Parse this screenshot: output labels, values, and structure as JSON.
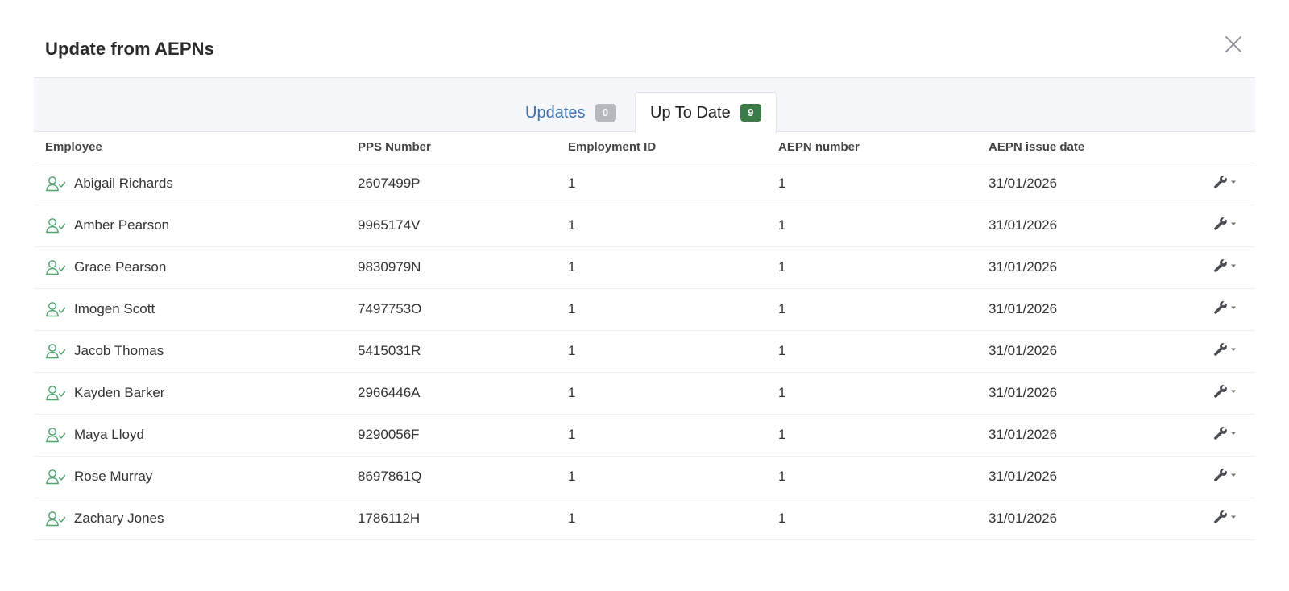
{
  "modal": {
    "title": "Update from AEPNs"
  },
  "tabs": [
    {
      "label": "Updates",
      "count": "0"
    },
    {
      "label": "Up To Date",
      "count": "9"
    }
  ],
  "table": {
    "headers": [
      "Employee",
      "PPS Number",
      "Employment ID",
      "AEPN number",
      "AEPN issue date"
    ],
    "rows": [
      {
        "name": "Abigail Richards",
        "pps": "2607499P",
        "employment_id": "1",
        "aepn_number": "1",
        "issue_date": "31/01/2026"
      },
      {
        "name": "Amber Pearson",
        "pps": "9965174V",
        "employment_id": "1",
        "aepn_number": "1",
        "issue_date": "31/01/2026"
      },
      {
        "name": "Grace Pearson",
        "pps": "9830979N",
        "employment_id": "1",
        "aepn_number": "1",
        "issue_date": "31/01/2026"
      },
      {
        "name": "Imogen Scott",
        "pps": "7497753O",
        "employment_id": "1",
        "aepn_number": "1",
        "issue_date": "31/01/2026"
      },
      {
        "name": "Jacob Thomas",
        "pps": "5415031R",
        "employment_id": "1",
        "aepn_number": "1",
        "issue_date": "31/01/2026"
      },
      {
        "name": "Kayden Barker",
        "pps": "2966446A",
        "employment_id": "1",
        "aepn_number": "1",
        "issue_date": "31/01/2026"
      },
      {
        "name": "Maya Lloyd",
        "pps": "9290056F",
        "employment_id": "1",
        "aepn_number": "1",
        "issue_date": "31/01/2026"
      },
      {
        "name": "Rose Murray",
        "pps": "8697861Q",
        "employment_id": "1",
        "aepn_number": "1",
        "issue_date": "31/01/2026"
      },
      {
        "name": "Zachary Jones",
        "pps": "1786112H",
        "employment_id": "1",
        "aepn_number": "1",
        "issue_date": "31/01/2026"
      }
    ]
  },
  "icons": {
    "close": "close-icon",
    "employee": "user-check-icon",
    "action": "wrench-icon",
    "dropdown": "caret-down-icon"
  },
  "colors": {
    "tab_link": "#3a6fb0",
    "badge_grey": "#b5b9be",
    "badge_green": "#3b7a49",
    "employee_icon": "#4aa36a"
  }
}
